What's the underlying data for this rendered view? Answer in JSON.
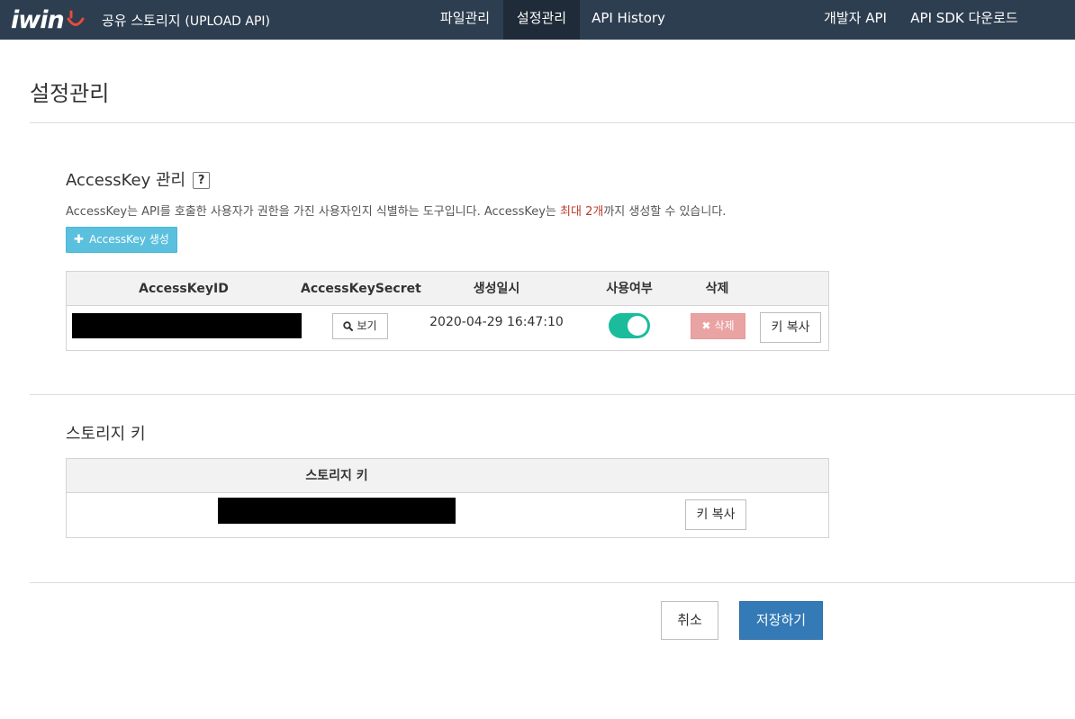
{
  "header": {
    "logo_text": "iwin",
    "app_title": "공유 스토리지",
    "app_subtitle": "(UPLOAD API)",
    "nav": [
      {
        "label": "파일관리",
        "active": false
      },
      {
        "label": "설정관리",
        "active": true
      },
      {
        "label": "API History",
        "active": false
      },
      {
        "label": "개발자 API",
        "active": false
      },
      {
        "label": "API SDK 다운로드",
        "active": false
      }
    ],
    "colors": {
      "bar": "#2d3e50",
      "active_tab": "#1f2b38",
      "logo_accent": "#e74c3c"
    }
  },
  "page": {
    "title": "설정관리"
  },
  "access_key": {
    "section_title": "AccessKey 관리",
    "help_label": "?",
    "description_prefix": "AccessKey는 API를 호출한 사용자가 권한을 가진 사용자인지 식별하는 도구입니다. AccessKey는 ",
    "description_highlight": "최대 2개",
    "description_suffix": "까지 생성할 수 있습니다.",
    "create_button": {
      "icon": "plus-icon",
      "label": "AccessKey 생성"
    },
    "columns": [
      "AccessKeyID",
      "AccessKeySecret",
      "생성일시",
      "사용여부",
      "삭제"
    ],
    "rows": [
      {
        "view_button": {
          "icon": "search-icon",
          "label": "보기"
        },
        "created_at": "2020-04-29 16:47:10",
        "enabled": true,
        "delete_button": {
          "icon": "close-icon",
          "label": "삭제"
        },
        "copy_button": "키 복사"
      }
    ],
    "colors": {
      "create": "#5bc0de",
      "toggle_on": "#1abc9c",
      "delete": "#eaa3a3",
      "highlight": "#c0392b"
    }
  },
  "storage_key": {
    "section_title": "스토리지 키",
    "columns": [
      "스토리지 키"
    ],
    "copy_button": "키 복사"
  },
  "footer": {
    "cancel_label": "취소",
    "save_label": "저장하기",
    "colors": {
      "save": "#337ab7"
    }
  }
}
